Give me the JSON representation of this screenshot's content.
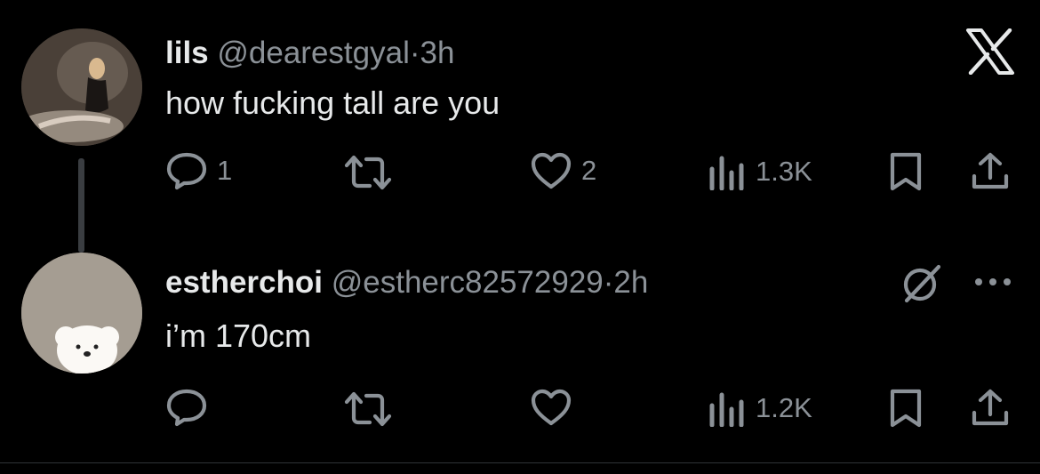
{
  "tweets": [
    {
      "display_name": "lils",
      "handle": "@dearestgyal",
      "separator": "·",
      "time": "3h",
      "text": "how fucking tall are you",
      "replies": "1",
      "retweets": "",
      "likes": "2",
      "views": "1.3K"
    },
    {
      "display_name": "estherchoi",
      "handle": "@estherc82572929",
      "separator": "·",
      "time": "2h",
      "text": "i’m 170cm",
      "replies": "",
      "retweets": "",
      "likes": "",
      "views": "1.2K"
    }
  ],
  "colors": {
    "background": "#000000",
    "text": "#e7e9ea",
    "muted": "#8b9197"
  },
  "icons": [
    "x-logo-icon",
    "reply-icon",
    "retweet-icon",
    "like-icon",
    "views-icon",
    "bookmark-icon",
    "share-icon",
    "grok-icon",
    "more-icon"
  ]
}
